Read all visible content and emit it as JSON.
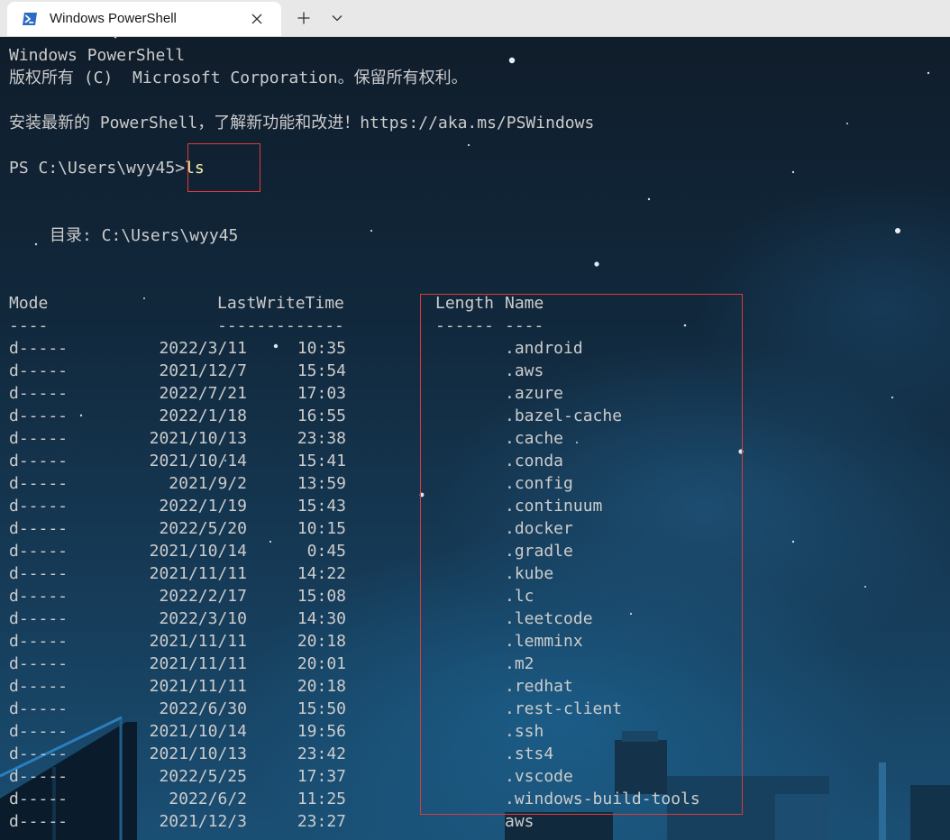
{
  "tab": {
    "title": "Windows PowerShell",
    "icon": "powershell-icon",
    "close_icon": "close-icon",
    "new_tab_icon": "plus-icon",
    "dropdown_icon": "chevron-down-icon"
  },
  "terminal": {
    "header_line1": "Windows PowerShell",
    "header_line2": "版权所有 (C)  Microsoft Corporation。保留所有权利。",
    "header_line3": "安装最新的 PowerShell，了解新功能和改进！https://aka.ms/PSWindows",
    "prompt": "PS C:\\Users\\wyy45>",
    "command": "ls",
    "directory_label": "目录: C:\\Users\\wyy45",
    "columns": {
      "mode": "Mode",
      "lastwritetime": "LastWriteTime",
      "length": "Length",
      "name": "Name"
    },
    "separators": {
      "mode": "----",
      "lastwritetime": "-------------",
      "length": "------",
      "name": "----"
    },
    "rows": [
      {
        "mode": "d-----",
        "date": "2022/3/11",
        "time": "10:35",
        "name": ".android"
      },
      {
        "mode": "d-----",
        "date": "2021/12/7",
        "time": "15:54",
        "name": ".aws"
      },
      {
        "mode": "d-----",
        "date": "2022/7/21",
        "time": "17:03",
        "name": ".azure"
      },
      {
        "mode": "d-----",
        "date": "2022/1/18",
        "time": "16:55",
        "name": ".bazel-cache"
      },
      {
        "mode": "d-----",
        "date": "2021/10/13",
        "time": "23:38",
        "name": ".cache"
      },
      {
        "mode": "d-----",
        "date": "2021/10/14",
        "time": "15:41",
        "name": ".conda"
      },
      {
        "mode": "d-----",
        "date": "2021/9/2",
        "time": "13:59",
        "name": ".config"
      },
      {
        "mode": "d-----",
        "date": "2022/1/19",
        "time": "15:43",
        "name": ".continuum"
      },
      {
        "mode": "d-----",
        "date": "2022/5/20",
        "time": "10:15",
        "name": ".docker"
      },
      {
        "mode": "d-----",
        "date": "2021/10/14",
        "time": "0:45",
        "name": ".gradle"
      },
      {
        "mode": "d-----",
        "date": "2021/11/11",
        "time": "14:22",
        "name": ".kube"
      },
      {
        "mode": "d-----",
        "date": "2022/2/17",
        "time": "15:08",
        "name": ".lc"
      },
      {
        "mode": "d-----",
        "date": "2022/3/10",
        "time": "14:30",
        "name": ".leetcode"
      },
      {
        "mode": "d-----",
        "date": "2021/11/11",
        "time": "20:18",
        "name": ".lemminx"
      },
      {
        "mode": "d-----",
        "date": "2021/11/11",
        "time": "20:01",
        "name": ".m2"
      },
      {
        "mode": "d-----",
        "date": "2021/11/11",
        "time": "20:18",
        "name": ".redhat"
      },
      {
        "mode": "d-----",
        "date": "2022/6/30",
        "time": "15:50",
        "name": ".rest-client"
      },
      {
        "mode": "d-----",
        "date": "2021/10/14",
        "time": "19:56",
        "name": ".ssh"
      },
      {
        "mode": "d-----",
        "date": "2021/10/13",
        "time": "23:42",
        "name": ".sts4"
      },
      {
        "mode": "d-----",
        "date": "2022/5/25",
        "time": "17:37",
        "name": ".vscode"
      },
      {
        "mode": "d-----",
        "date": "2022/6/2",
        "time": "11:25",
        "name": ".windows-build-tools"
      },
      {
        "mode": "d-----",
        "date": "2021/12/3",
        "time": "23:27",
        "name": "aws"
      }
    ],
    "colors": {
      "text": "#cccccc",
      "command": "#f9f1a5",
      "highlight": "#e0393b",
      "titlebar": "#e8e8e8"
    }
  }
}
